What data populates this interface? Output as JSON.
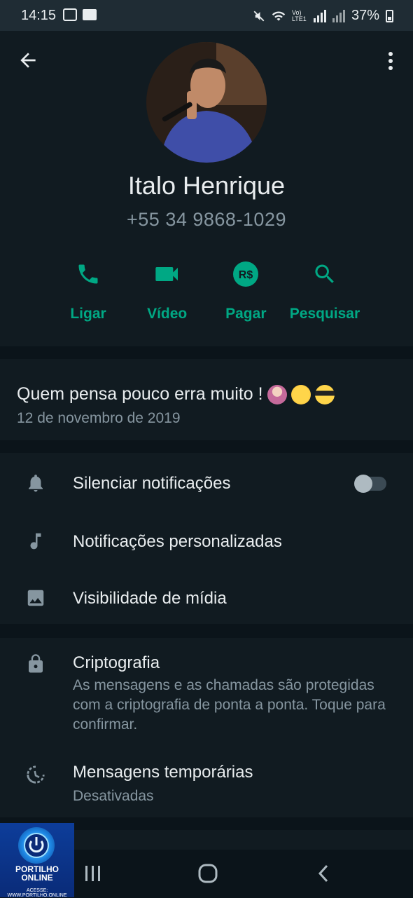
{
  "status_bar": {
    "time": "14:15",
    "network_label": "Vo) LTE1",
    "battery": "37%"
  },
  "contact": {
    "name": "Italo Henrique",
    "phone": "+55 34 9868-1029"
  },
  "actions": [
    {
      "label": "Ligar",
      "icon": "phone-icon"
    },
    {
      "label": "Vídeo",
      "icon": "video-icon"
    },
    {
      "label": "Pagar",
      "icon": "payment-icon"
    },
    {
      "label": "Pesquisar",
      "icon": "search-icon"
    }
  ],
  "about": {
    "text": "Quem pensa pouco erra muito !",
    "date": "12 de novembro de 2019"
  },
  "settings": {
    "mute_label": "Silenciar notificações",
    "mute_enabled": false,
    "custom_notifications_label": "Notificações personalizadas",
    "media_visibility_label": "Visibilidade de mídia"
  },
  "security": {
    "encryption_title": "Criptografia",
    "encryption_subtitle": "As mensagens e as chamadas são protegidas com a criptografia de ponta a ponta. Toque para confirmar.",
    "disappearing_title": "Mensagens temporárias",
    "disappearing_subtitle": "Desativadas"
  },
  "watermark": {
    "line1": "PORTILHO",
    "line2": "ONLINE",
    "line3": "ACESSE: WWW.PORTILHO.ONLINE"
  },
  "colors": {
    "accent": "#00a884",
    "background": "#0b141a",
    "surface": "#111b21",
    "text_secondary": "#8696a0"
  }
}
